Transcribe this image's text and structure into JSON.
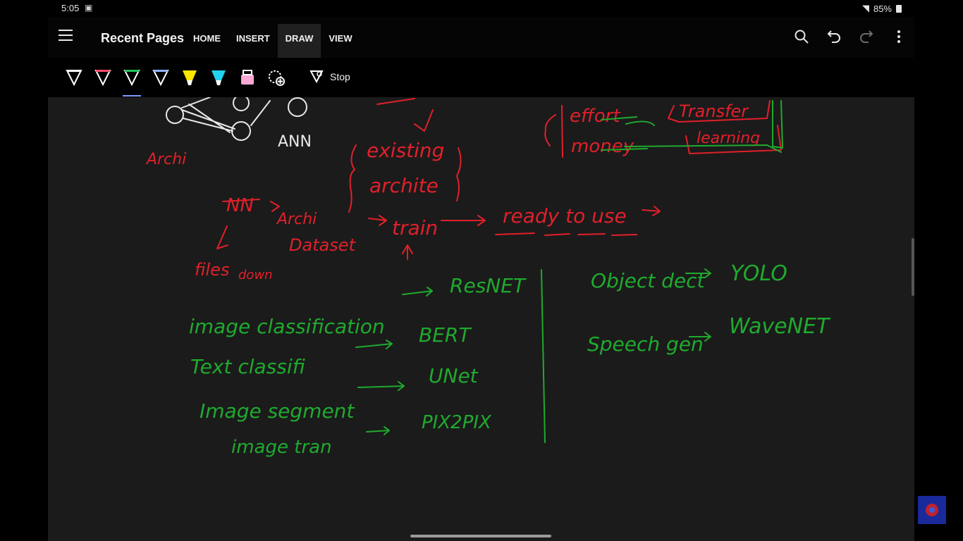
{
  "status": {
    "time": "5:05",
    "battery": "85%"
  },
  "header": {
    "title": "Recent Pages",
    "tabs": [
      {
        "label": "HOME"
      },
      {
        "label": "INSERT"
      },
      {
        "label": "DRAW"
      },
      {
        "label": "VIEW"
      }
    ],
    "active_tab": "DRAW"
  },
  "toolbar": {
    "pens": [
      {
        "name": "black-pen",
        "color": "#ffffff"
      },
      {
        "name": "red-pen",
        "color": "#ff4d6a"
      },
      {
        "name": "green-pen",
        "color": "#22c55e"
      },
      {
        "name": "blue-pen",
        "color": "#8fb4ff"
      },
      {
        "name": "yellow-highlighter",
        "color": "#ffe600"
      },
      {
        "name": "cyan-highlighter",
        "color": "#22d3ee"
      },
      {
        "name": "pink-highlighter",
        "color": "#f9a8d4"
      }
    ],
    "stop_label": "Stop"
  },
  "canvas": {
    "red_notes": [
      "Archi",
      "ANN",
      "existing",
      "archite",
      "NN",
      "Archi",
      "Dataset",
      "train",
      "ready to use",
      "files",
      "down",
      "effort",
      "money",
      "Transfer",
      "learning"
    ],
    "green_notes": [
      "image classification",
      "ResNET",
      "Text classifi",
      "BERT",
      "Image segment",
      "UNet",
      "image tran",
      "PIX2PIX",
      "Object dect",
      "YOLO",
      "Speech gen",
      "WaveNET"
    ],
    "colors": {
      "red_ink": "#e0202a",
      "green_ink": "#1faa2e",
      "white_ink": "#e8e8e8"
    }
  }
}
